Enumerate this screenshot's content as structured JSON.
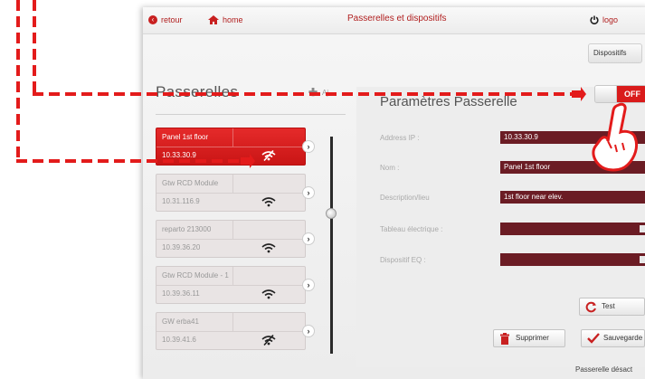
{
  "topbar": {
    "back_label": "retour",
    "home_label": "home",
    "title": "Passerelles et dispositifs",
    "logout_label": "logo"
  },
  "tabs": {
    "dispositifs_label": "Dispositifs"
  },
  "left": {
    "title": "Passerelles",
    "add_label": "Aj"
  },
  "gateways": [
    {
      "name": "Panel 1st floor",
      "ip": "10.33.30.9",
      "selected": true,
      "wifi": "off"
    },
    {
      "name": "Gtw RCD Module",
      "ip": "10.31.116.9",
      "selected": false,
      "wifi": "on"
    },
    {
      "name": "reparto 213000",
      "ip": "10.39.36.20",
      "selected": false,
      "wifi": "on"
    },
    {
      "name": "Gtw RCD Module - 1",
      "ip": "10.39.36.11",
      "selected": false,
      "wifi": "on"
    },
    {
      "name": "GW erba41",
      "ip": "10.39.41.6",
      "selected": false,
      "wifi": "off"
    }
  ],
  "right": {
    "title": "Paramètres Passerelle",
    "toggle_label": "OFF",
    "fields": [
      {
        "label": "Address IP :",
        "value": "10.33.30.9"
      },
      {
        "label": "Nom :",
        "value": "Panel 1st floor"
      },
      {
        "label": "Description/lieu",
        "value": "1st floor near elev."
      },
      {
        "label": "Tableau électrique :",
        "value": ""
      },
      {
        "label": "Dispositif EQ :",
        "value": ""
      }
    ],
    "test_label": "Test",
    "delete_label": "Supprimer",
    "save_label": "Sauvegarde",
    "status_text": "Passerelle désact"
  },
  "colors": {
    "accent": "#d91b1b",
    "field_bg": "#6b1c24",
    "dash": "#e31b1b"
  }
}
